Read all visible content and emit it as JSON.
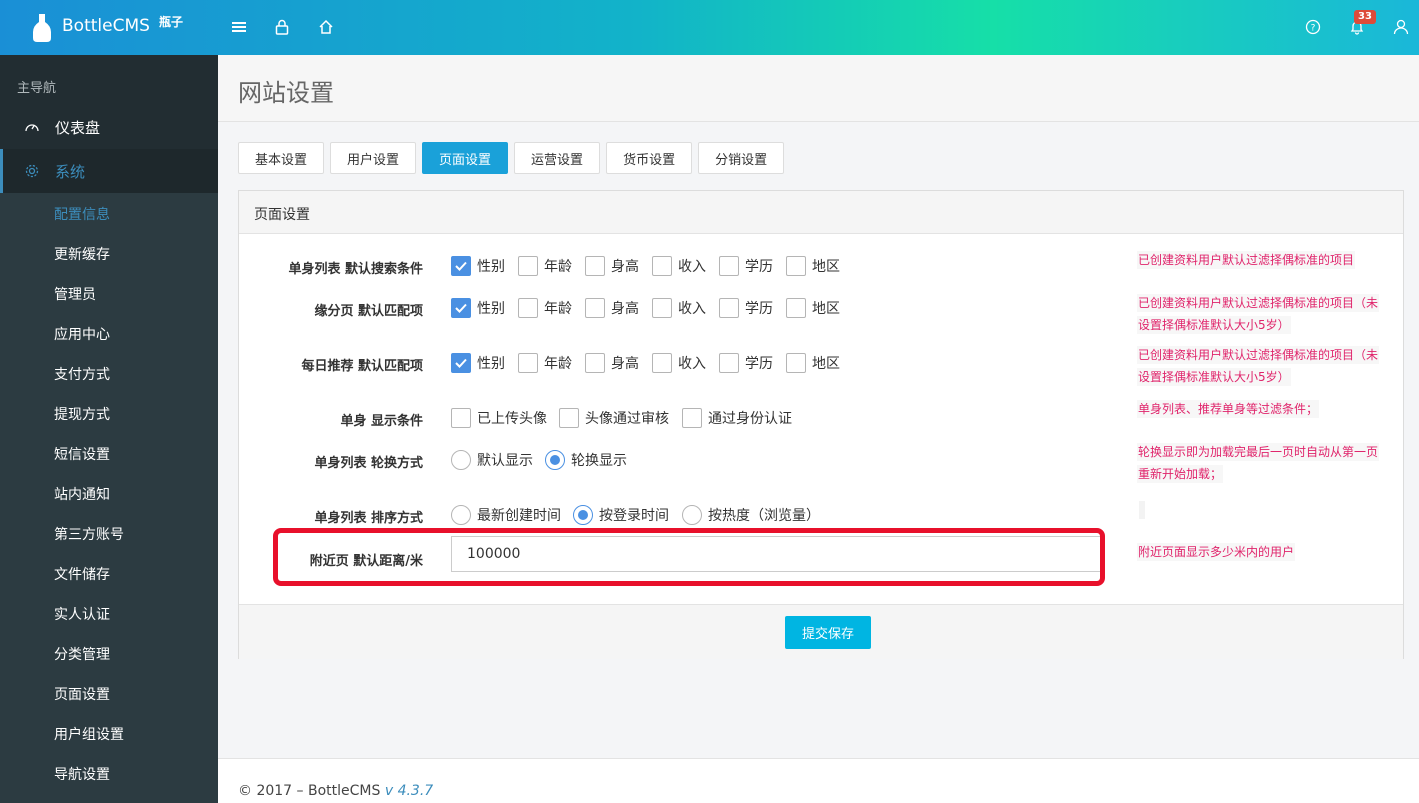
{
  "header": {
    "logo_text": "BottleCMS",
    "logo_sub": "瓶子",
    "notification_count": "33"
  },
  "sidebar": {
    "section_title": "主导航",
    "top_items": [
      {
        "label": "仪表盘",
        "icon": "dashboard-icon"
      },
      {
        "label": "系统",
        "icon": "gear-icon"
      }
    ],
    "sub_items": [
      {
        "label": "配置信息"
      },
      {
        "label": "更新缓存"
      },
      {
        "label": "管理员"
      },
      {
        "label": "应用中心"
      },
      {
        "label": "支付方式"
      },
      {
        "label": "提现方式"
      },
      {
        "label": "短信设置"
      },
      {
        "label": "站内通知"
      },
      {
        "label": "第三方账号"
      },
      {
        "label": "文件储存"
      },
      {
        "label": "实人认证"
      },
      {
        "label": "分类管理"
      },
      {
        "label": "页面设置"
      },
      {
        "label": "用户组设置"
      },
      {
        "label": "导航设置"
      }
    ],
    "active_sub": "配置信息"
  },
  "page": {
    "title": "网站设置",
    "tabs": [
      "基本设置",
      "用户设置",
      "页面设置",
      "运营设置",
      "货币设置",
      "分销设置"
    ],
    "active_tab": "页面设置"
  },
  "panel": {
    "title": "页面设置",
    "rows": [
      {
        "label": "单身列表 默认搜索条件",
        "options": [
          {
            "label": "性别",
            "checked": true
          },
          {
            "label": "年龄",
            "checked": false
          },
          {
            "label": "身高",
            "checked": false
          },
          {
            "label": "收入",
            "checked": false
          },
          {
            "label": "学历",
            "checked": false
          },
          {
            "label": "地区",
            "checked": false
          }
        ],
        "hint": [
          "已创建资料用户默认过滤择偶标准的项目"
        ]
      },
      {
        "label": "缘分页 默认匹配项",
        "options": [
          {
            "label": "性别",
            "checked": true
          },
          {
            "label": "年龄",
            "checked": false
          },
          {
            "label": "身高",
            "checked": false
          },
          {
            "label": "收入",
            "checked": false
          },
          {
            "label": "学历",
            "checked": false
          },
          {
            "label": "地区",
            "checked": false
          }
        ],
        "hint": [
          "已创建资料用户默认过滤择偶标准的项目（未",
          "设置择偶标准默认大小5岁）"
        ]
      },
      {
        "label": "每日推荐 默认匹配项",
        "options": [
          {
            "label": "性别",
            "checked": true
          },
          {
            "label": "年龄",
            "checked": false
          },
          {
            "label": "身高",
            "checked": false
          },
          {
            "label": "收入",
            "checked": false
          },
          {
            "label": "学历",
            "checked": false
          },
          {
            "label": "地区",
            "checked": false
          }
        ],
        "hint": [
          "已创建资料用户默认过滤择偶标准的项目（未",
          "设置择偶标准默认大小5岁）"
        ]
      },
      {
        "label": "单身 显示条件",
        "options": [
          {
            "label": "已上传头像",
            "checked": false
          },
          {
            "label": "头像通过审核",
            "checked": false
          },
          {
            "label": "通过身份认证",
            "checked": false
          }
        ],
        "hint": [
          "单身列表、推荐单身等过滤条件；"
        ]
      },
      {
        "label": "单身列表 轮换方式",
        "options": [
          {
            "label": "默认显示",
            "checked": false
          },
          {
            "label": "轮换显示",
            "checked": true
          }
        ],
        "hint": [
          "轮换显示即为加载完最后一页时自动从第一页",
          "重新开始加载；"
        ]
      },
      {
        "label": "单身列表 排序方式",
        "options": [
          {
            "label": "最新创建时间",
            "checked": false
          },
          {
            "label": "按登录时间",
            "checked": true
          },
          {
            "label": "按热度（浏览量）",
            "checked": false
          }
        ]
      }
    ],
    "distance": {
      "label": "附近页 默认距离/米",
      "value": "100000",
      "hint": "附近页面显示多少米内的用户"
    },
    "submit_label": "提交保存"
  },
  "footer": {
    "copyright": "© 2017 – BottleCMS",
    "version": "v 4.3.7"
  }
}
